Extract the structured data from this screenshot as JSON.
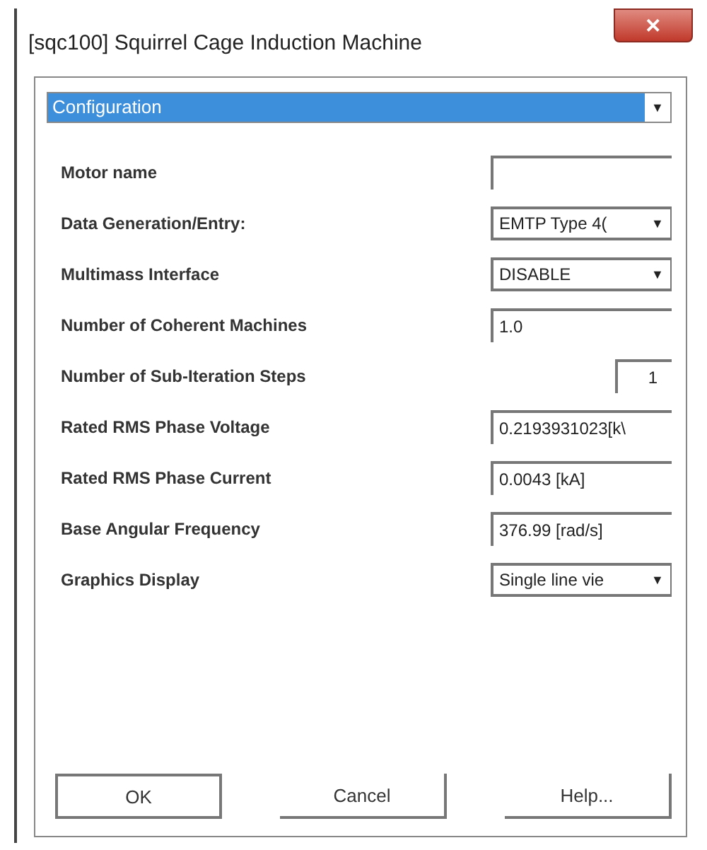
{
  "window": {
    "title": "[sqc100] Squirrel Cage Induction Machine",
    "close": "✕"
  },
  "section": {
    "value": "Configuration",
    "arrow": "▼"
  },
  "fields": [
    {
      "label": "Motor name",
      "kind": "text"
    },
    {
      "label": "Data Generation/Entry:",
      "kind": "dropdown",
      "value": "EMTP Type 4(",
      "arrow": "▼"
    },
    {
      "label": "Multimass Interface",
      "kind": "dropdown",
      "value": "DISABLE",
      "arrow": "▼"
    },
    {
      "label": "Number of Coherent Machines",
      "kind": "text",
      "value": "1.0"
    },
    {
      "label": "Number of Sub-Iteration Steps",
      "kind": "short",
      "value": "1"
    },
    {
      "label": "Rated RMS Phase Voltage",
      "kind": "text",
      "value": "0.2193931023[k\\"
    },
    {
      "label": "Rated RMS Phase Current",
      "kind": "text",
      "value": "0.0043 [kA]"
    },
    {
      "label": "Base Angular Frequency",
      "kind": "text",
      "value": "376.99 [rad/s]"
    },
    {
      "label": "Graphics Display",
      "kind": "dropdown",
      "value": "Single line vie",
      "arrow": "▼"
    }
  ],
  "buttons": [
    "OK",
    "Cancel",
    "Help..."
  ]
}
